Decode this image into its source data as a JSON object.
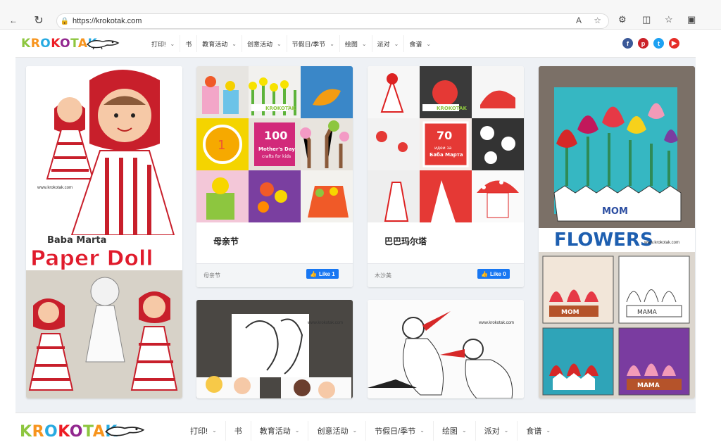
{
  "browser": {
    "url": "https://krokotak.com",
    "icons": [
      "back-icon",
      "refresh-icon",
      "lock-icon",
      "read-aloud-icon",
      "favorite-icon",
      "extensions-icon",
      "split-screen-icon",
      "favorites-icon",
      "collections-icon"
    ]
  },
  "site": {
    "logo_text": "KROKOTAK",
    "menu": [
      {
        "label": "打印!",
        "dropdown": true
      },
      {
        "label": "书",
        "dropdown": false
      },
      {
        "label": "教育活动",
        "dropdown": true
      },
      {
        "label": "创意活动",
        "dropdown": true
      },
      {
        "label": "节假日/季节",
        "dropdown": true
      },
      {
        "label": "绘图",
        "dropdown": true
      },
      {
        "label": "派对",
        "dropdown": true
      },
      {
        "label": "食谱",
        "dropdown": true
      }
    ],
    "social": [
      {
        "name": "facebook-icon",
        "glyph": "f",
        "color": "#3b5998"
      },
      {
        "name": "pinterest-icon",
        "glyph": "p",
        "color": "#cb2027"
      },
      {
        "name": "twitter-icon",
        "glyph": "t",
        "color": "#1da1f2"
      },
      {
        "name": "youtube-icon",
        "glyph": "▶",
        "color": "#e52d27"
      }
    ]
  },
  "cards": {
    "paper_doll": {
      "line1": "Baba Marta",
      "line2": "Paper Doll",
      "watermark": "www.krokotak.com"
    },
    "mothers_day": {
      "title": "母亲节",
      "tag": "母亲节",
      "like": "Like 1",
      "tile_number": "100",
      "tile_line1": "Mother's Day",
      "tile_line2": "crafts for kids"
    },
    "baba_marta": {
      "title": "巴巴玛尔塔",
      "tag": "木沙美",
      "like": "Like 0",
      "tile_number": "70",
      "tile_line1": "идеи за",
      "tile_line2": "Баба Марта"
    },
    "flowers": {
      "heading": "FLOWERS",
      "watermark": "www.krokotak.com",
      "mom1": "MOM",
      "mom2": "MOM",
      "mama1": "MAMA",
      "mama2": "MAMA"
    },
    "hug": {
      "watermark": "www.krokotak.com"
    },
    "storks": {
      "watermark": "www.krokotak.com"
    }
  }
}
